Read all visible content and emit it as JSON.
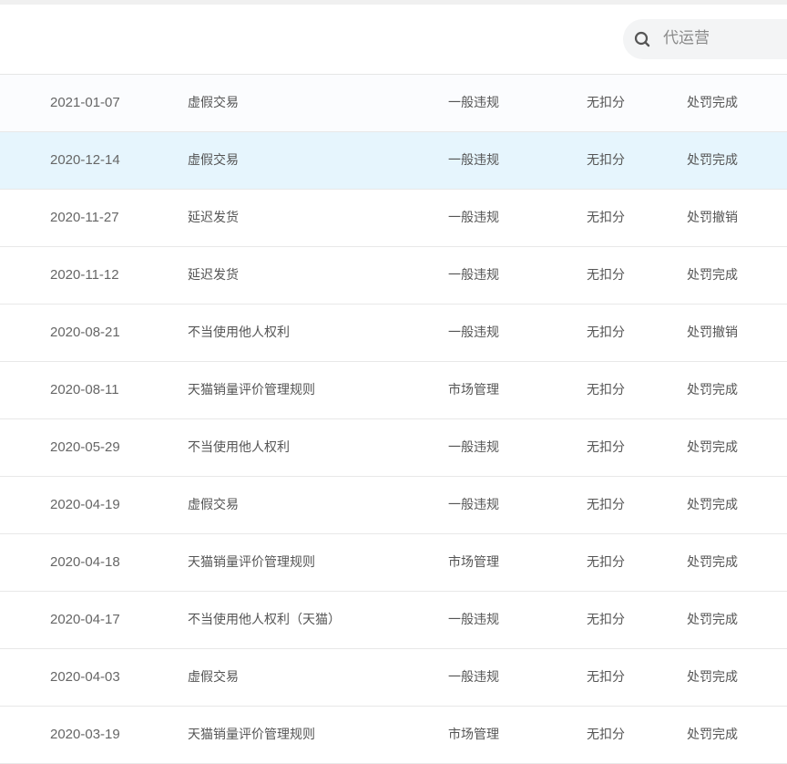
{
  "search": {
    "placeholder": "代运营"
  },
  "rows": [
    {
      "date": "2021-01-07",
      "reason": "虚假交易",
      "type": "一般违规",
      "score": "无扣分",
      "status": "处罚完成"
    },
    {
      "date": "2020-12-14",
      "reason": "虚假交易",
      "type": "一般违规",
      "score": "无扣分",
      "status": "处罚完成"
    },
    {
      "date": "2020-11-27",
      "reason": "延迟发货",
      "type": "一般违规",
      "score": "无扣分",
      "status": "处罚撤销"
    },
    {
      "date": "2020-11-12",
      "reason": "延迟发货",
      "type": "一般违规",
      "score": "无扣分",
      "status": "处罚完成"
    },
    {
      "date": "2020-08-21",
      "reason": "不当使用他人权利",
      "type": "一般违规",
      "score": "无扣分",
      "status": "处罚撤销"
    },
    {
      "date": "2020-08-11",
      "reason": "天猫销量评价管理规则",
      "type": "市场管理",
      "score": "无扣分",
      "status": "处罚完成"
    },
    {
      "date": "2020-05-29",
      "reason": "不当使用他人权利",
      "type": "一般违规",
      "score": "无扣分",
      "status": "处罚完成"
    },
    {
      "date": "2020-04-19",
      "reason": "虚假交易",
      "type": "一般违规",
      "score": "无扣分",
      "status": "处罚完成"
    },
    {
      "date": "2020-04-18",
      "reason": "天猫销量评价管理规则",
      "type": "市场管理",
      "score": "无扣分",
      "status": "处罚完成"
    },
    {
      "date": "2020-04-17",
      "reason": "不当使用他人权利（天猫）",
      "type": "一般违规",
      "score": "无扣分",
      "status": "处罚完成"
    },
    {
      "date": "2020-04-03",
      "reason": "虚假交易",
      "type": "一般违规",
      "score": "无扣分",
      "status": "处罚完成"
    },
    {
      "date": "2020-03-19",
      "reason": "天猫销量评价管理规则",
      "type": "市场管理",
      "score": "无扣分",
      "status": "处罚完成"
    }
  ],
  "highlighted_row": 1
}
